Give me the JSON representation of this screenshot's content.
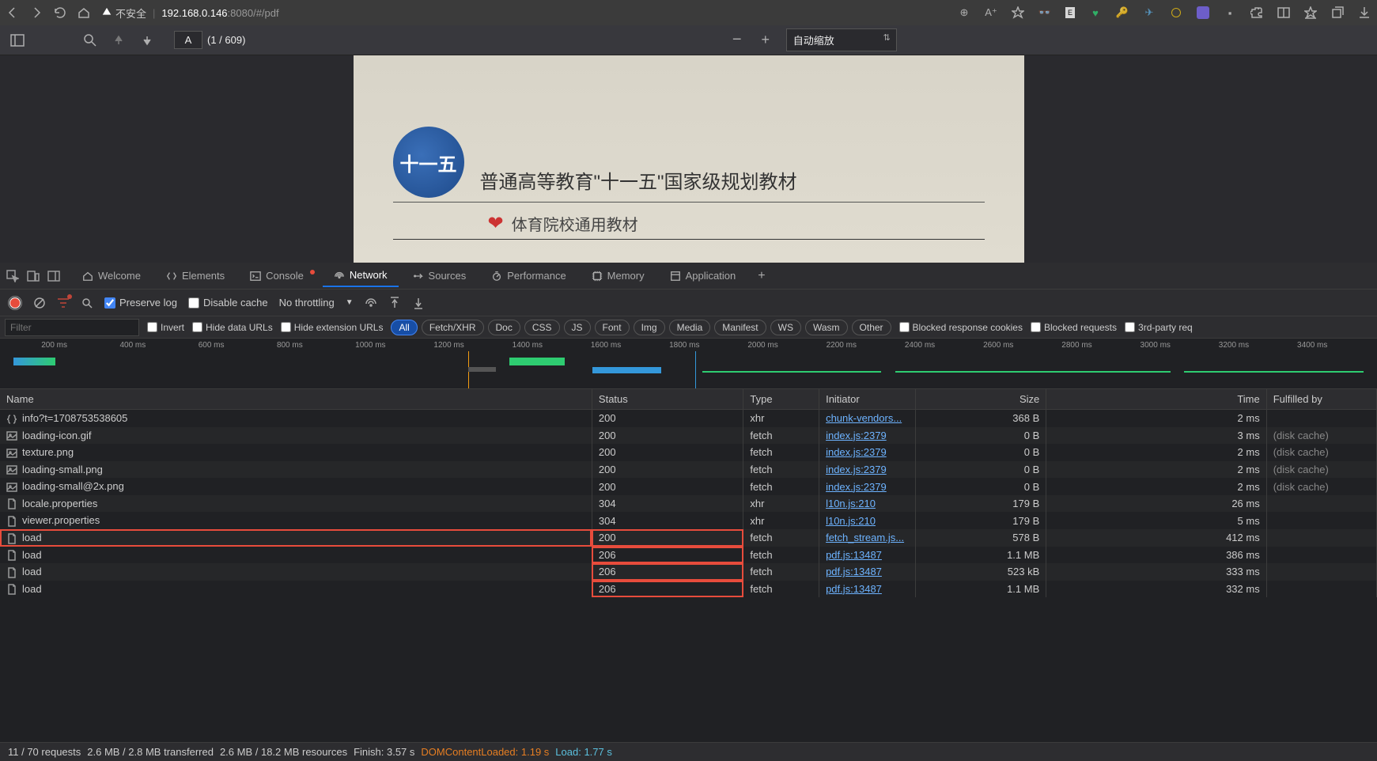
{
  "browser": {
    "security_label": "不安全",
    "url_host": "192.168.0.146",
    "url_port_path": ":8080/#/pdf"
  },
  "pdf": {
    "page_letter": "A",
    "page_indicator": "(1 / 609)",
    "zoom_label": "自动缩放",
    "doc_title": "普通高等教育\"十一五\"国家级规划教材",
    "doc_sub": "体育院校通用教材",
    "logo_text": "十一五"
  },
  "devtools": {
    "tabs": {
      "welcome": "Welcome",
      "elements": "Elements",
      "console": "Console",
      "network": "Network",
      "sources": "Sources",
      "performance": "Performance",
      "memory": "Memory",
      "application": "Application"
    },
    "toolbar": {
      "preserve": "Preserve log",
      "disable_cache": "Disable cache",
      "throttle": "No throttling"
    },
    "filter": {
      "placeholder": "Filter",
      "invert": "Invert",
      "hide_data": "Hide data URLs",
      "hide_ext": "Hide extension URLs",
      "blocked_cookies": "Blocked response cookies",
      "blocked": "Blocked requests",
      "third": "3rd-party req"
    },
    "pills": [
      "All",
      "Fetch/XHR",
      "Doc",
      "CSS",
      "JS",
      "Font",
      "Img",
      "Media",
      "Manifest",
      "WS",
      "Wasm",
      "Other"
    ],
    "timeline_ticks": [
      "200 ms",
      "400 ms",
      "600 ms",
      "800 ms",
      "1000 ms",
      "1200 ms",
      "1400 ms",
      "1600 ms",
      "1800 ms",
      "2000 ms",
      "2200 ms",
      "2400 ms",
      "2600 ms",
      "2800 ms",
      "3000 ms",
      "3200 ms",
      "3400 ms"
    ],
    "columns": {
      "name": "Name",
      "status": "Status",
      "type": "Type",
      "initiator": "Initiator",
      "size": "Size",
      "time": "Time",
      "fulfilled": "Fulfilled by"
    },
    "rows": [
      {
        "icon": "json",
        "name": "info?t=1708753538605",
        "status": "200",
        "type": "xhr",
        "initiator": "chunk-vendors...",
        "size": "368 B",
        "time": "2 ms",
        "fulfilled": ""
      },
      {
        "icon": "img",
        "name": "loading-icon.gif",
        "status": "200",
        "type": "fetch",
        "initiator": "index.js:2379",
        "size": "0 B",
        "time": "3 ms",
        "fulfilled": "(disk cache)"
      },
      {
        "icon": "img",
        "name": "texture.png",
        "status": "200",
        "type": "fetch",
        "initiator": "index.js:2379",
        "size": "0 B",
        "time": "2 ms",
        "fulfilled": "(disk cache)"
      },
      {
        "icon": "img",
        "name": "loading-small.png",
        "status": "200",
        "type": "fetch",
        "initiator": "index.js:2379",
        "size": "0 B",
        "time": "2 ms",
        "fulfilled": "(disk cache)"
      },
      {
        "icon": "img",
        "name": "loading-small@2x.png",
        "status": "200",
        "type": "fetch",
        "initiator": "index.js:2379",
        "size": "0 B",
        "time": "2 ms",
        "fulfilled": "(disk cache)"
      },
      {
        "icon": "doc",
        "name": "locale.properties",
        "status": "304",
        "type": "xhr",
        "initiator": "l10n.js:210",
        "size": "179 B",
        "time": "26 ms",
        "fulfilled": ""
      },
      {
        "icon": "doc",
        "name": "viewer.properties",
        "status": "304",
        "type": "xhr",
        "initiator": "l10n.js:210",
        "size": "179 B",
        "time": "5 ms",
        "fulfilled": ""
      },
      {
        "icon": "doc",
        "name": "load",
        "status": "200",
        "type": "fetch",
        "initiator": "fetch_stream.js...",
        "size": "578 B",
        "time": "412 ms",
        "fulfilled": "",
        "hl_row": true
      },
      {
        "icon": "doc",
        "name": "load",
        "status": "206",
        "type": "fetch",
        "initiator": "pdf.js:13487",
        "size": "1.1 MB",
        "time": "386 ms",
        "fulfilled": "",
        "hl_status": true
      },
      {
        "icon": "doc",
        "name": "load",
        "status": "206",
        "type": "fetch",
        "initiator": "pdf.js:13487",
        "size": "523 kB",
        "time": "333 ms",
        "fulfilled": "",
        "hl_status": true
      },
      {
        "icon": "doc",
        "name": "load",
        "status": "206",
        "type": "fetch",
        "initiator": "pdf.js:13487",
        "size": "1.1 MB",
        "time": "332 ms",
        "fulfilled": "",
        "hl_status": true
      }
    ],
    "status": {
      "requests": "11 / 70 requests",
      "transferred": "2.6 MB / 2.8 MB transferred",
      "resources": "2.6 MB / 18.2 MB resources",
      "finish": "Finish: 3.57 s",
      "dom": "DOMContentLoaded: 1.19 s",
      "load": "Load: 1.77 s"
    }
  }
}
